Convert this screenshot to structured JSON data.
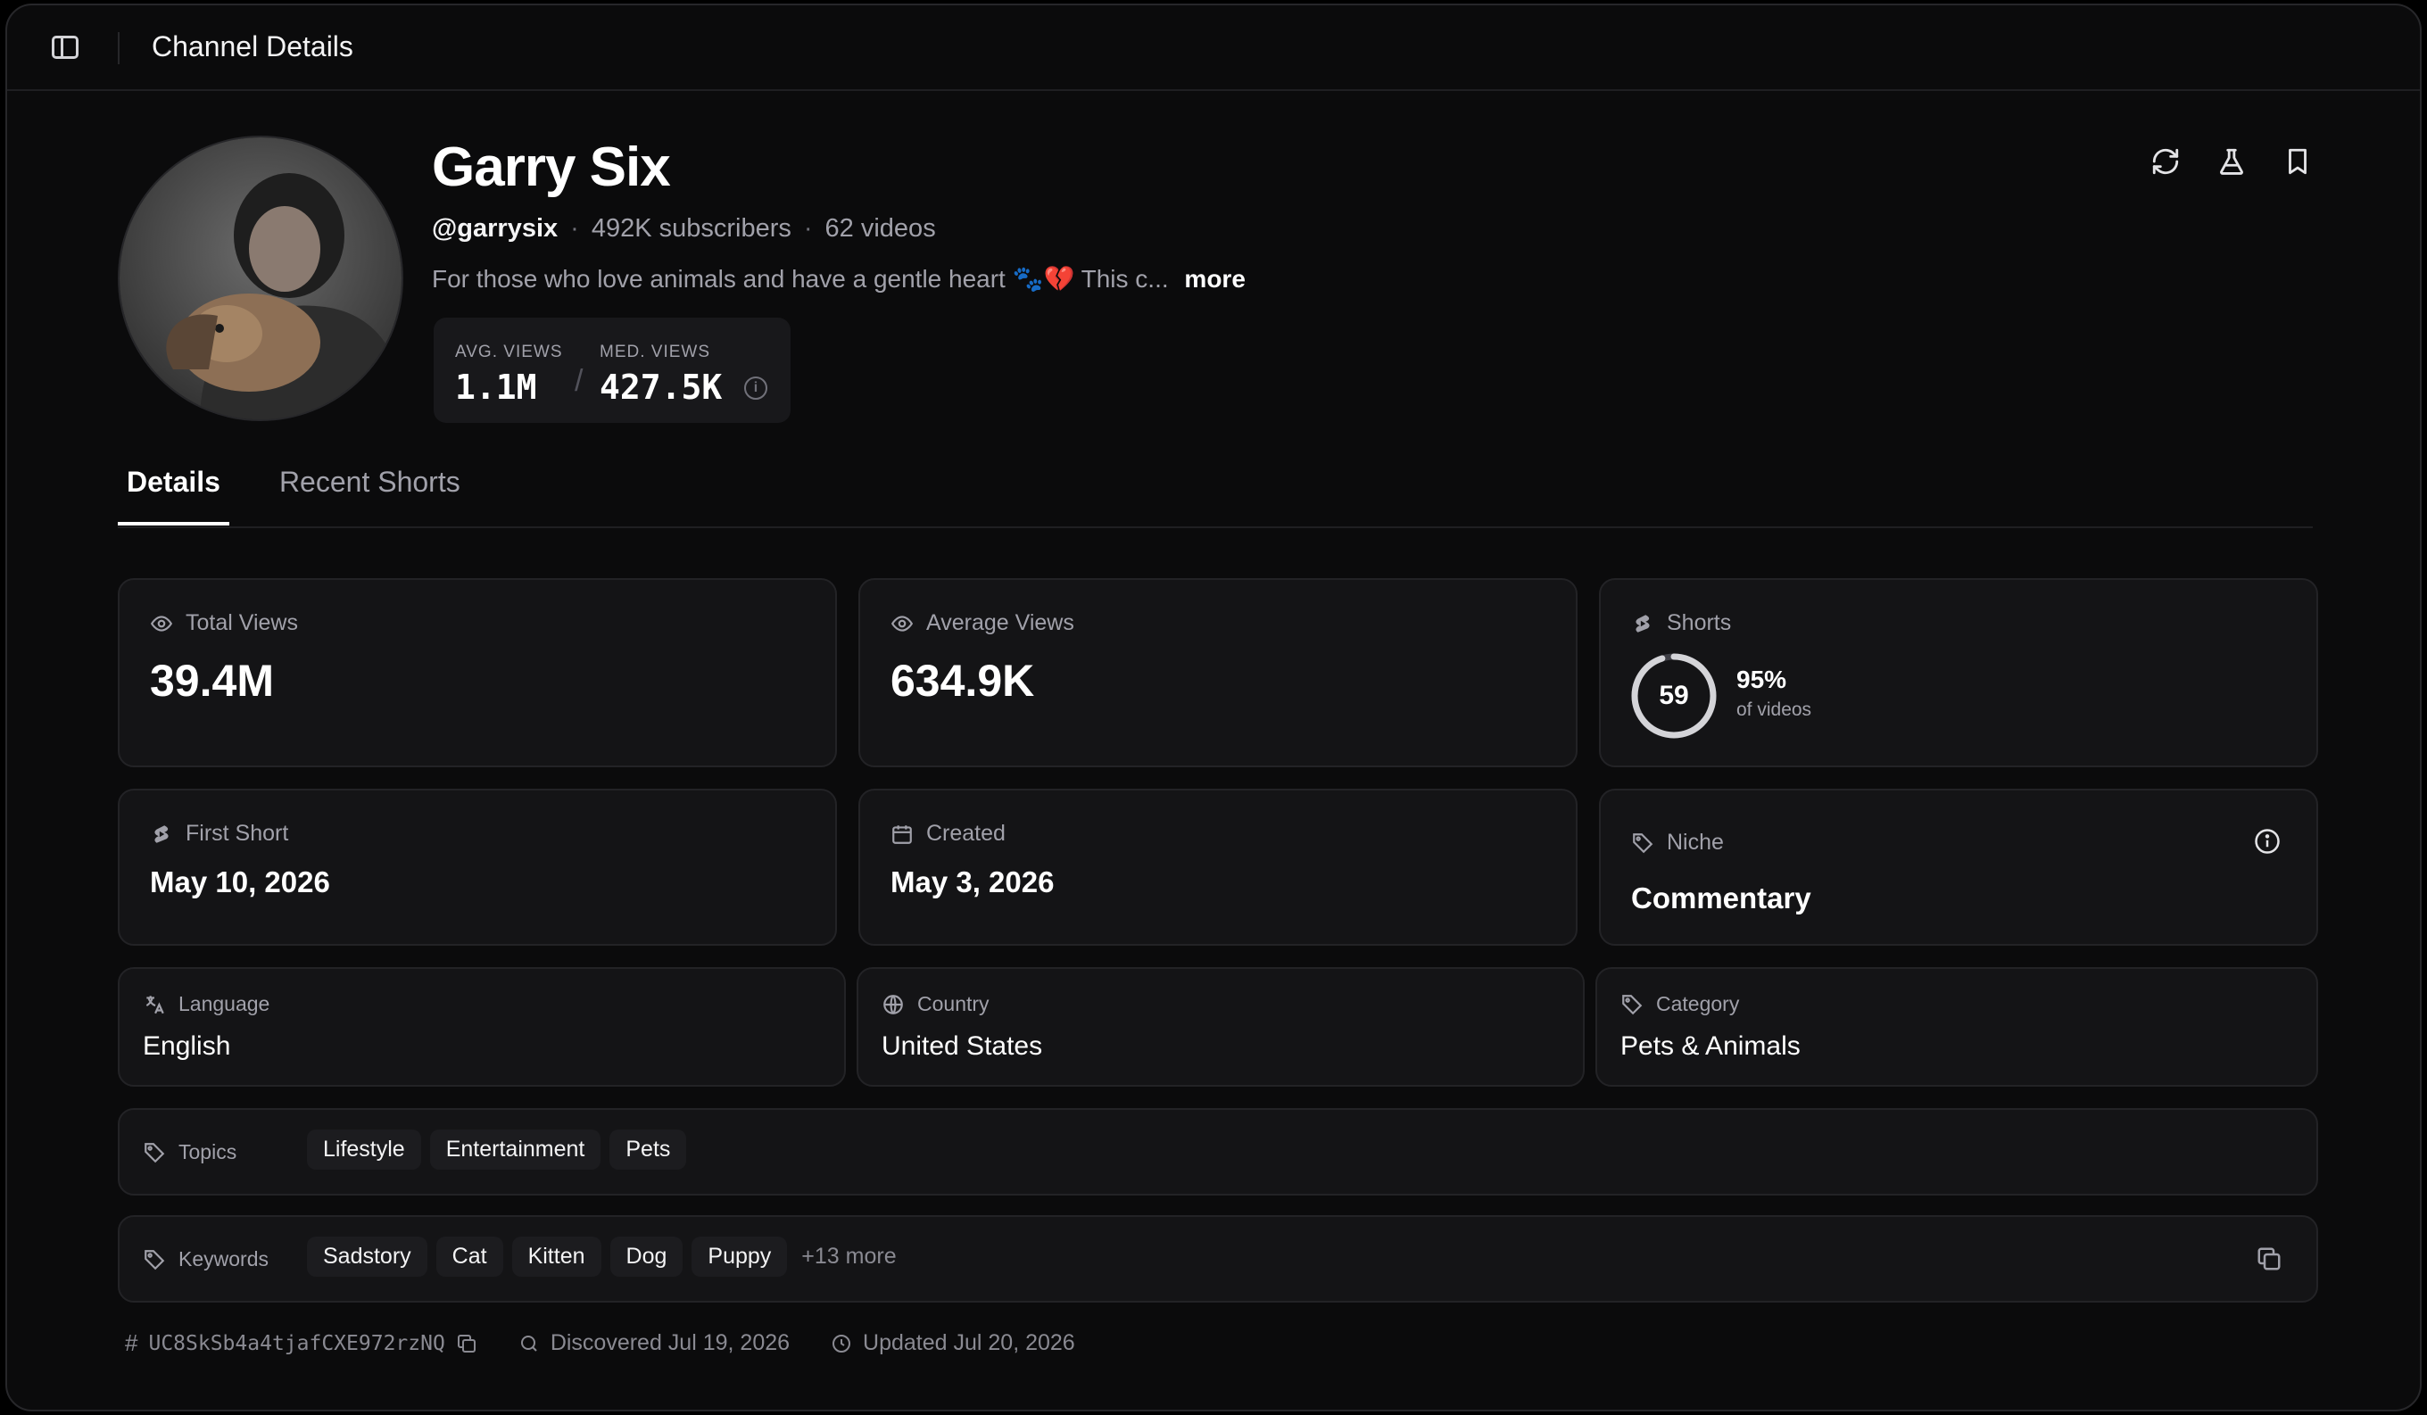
{
  "topbar": {
    "title": "Channel Details"
  },
  "channel": {
    "name": "Garry Six",
    "handle": "@garrysix",
    "subscribers": "492K subscribers",
    "videos": "62 videos",
    "description": "For those who love animals and have a gentle heart 🐾💔 This c...",
    "more_label": "more"
  },
  "view_stats": {
    "avg_label": "AVG. VIEWS",
    "avg_value": "1.1M",
    "med_label": "MED. VIEWS",
    "med_value": "427.5K"
  },
  "tabs": [
    {
      "label": "Details",
      "active": true
    },
    {
      "label": "Recent Shorts",
      "active": false
    }
  ],
  "cards": {
    "total_views": {
      "label": "Total Views",
      "value": "39.4M"
    },
    "average_views": {
      "label": "Average Views",
      "value": "634.9K"
    },
    "shorts": {
      "label": "Shorts",
      "count": "59",
      "percent": "95%",
      "percent_sub": "of videos",
      "fraction": 0.95
    },
    "first_short": {
      "label": "First Short",
      "value": "May 10, 2026"
    },
    "created": {
      "label": "Created",
      "value": "May 3, 2026"
    },
    "niche": {
      "label": "Niche",
      "value": "Commentary"
    },
    "language": {
      "label": "Language",
      "value": "English"
    },
    "country": {
      "label": "Country",
      "value": "United States"
    },
    "category": {
      "label": "Category",
      "value": "Pets & Animals"
    }
  },
  "topics": {
    "label": "Topics",
    "items": [
      "Lifestyle",
      "Entertainment",
      "Pets"
    ]
  },
  "keywords": {
    "label": "Keywords",
    "items": [
      "Sadstory",
      "Cat",
      "Kitten",
      "Dog",
      "Puppy"
    ],
    "more": "+13 more"
  },
  "footer": {
    "channel_id": "UC8SkSb4a4tjafCXE972rzNQ",
    "discovered": "Discovered Jul 19, 2026",
    "updated": "Updated Jul 20, 2026"
  }
}
